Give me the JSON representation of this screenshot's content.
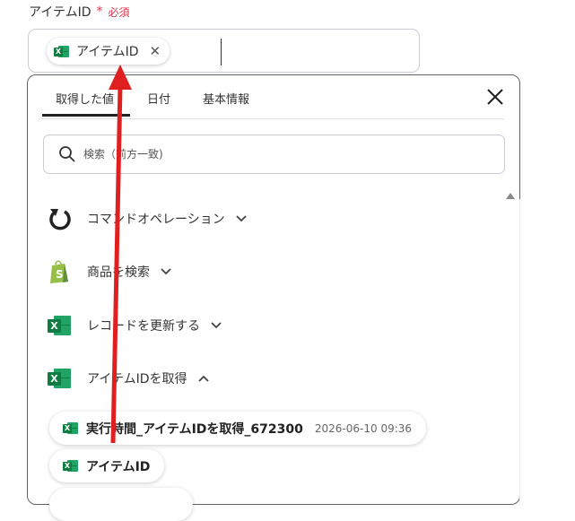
{
  "field": {
    "label": "アイテムID",
    "required_star": "*",
    "required_text": "必須",
    "chip_label": "アイテムID",
    "chip_close": "✕"
  },
  "panel": {
    "tabs": [
      {
        "label": "取得した値",
        "active": true
      },
      {
        "label": "日付",
        "active": false
      },
      {
        "label": "基本情報",
        "active": false
      }
    ],
    "close_icon": "close-icon",
    "search_placeholder": "検索（前方一致)"
  },
  "operations": [
    {
      "label": "コマンドオペレーション",
      "icon": "command-operation-icon",
      "expanded": false
    },
    {
      "label": "商品を検索",
      "icon": "shopify-icon",
      "expanded": false
    },
    {
      "label": "レコードを更新する",
      "icon": "excel-icon",
      "expanded": false
    },
    {
      "label": "アイテムIDを取得",
      "icon": "excel-icon",
      "expanded": true
    }
  ],
  "results": [
    {
      "label": "実行時間_アイテムIDを取得_672300",
      "timestamp": "2026-06-10 09:36"
    },
    {
      "label": "アイテムID"
    }
  ],
  "colors": {
    "required": "#e0344c",
    "excel_green": "#107c41",
    "shopify_green": "#95bf47",
    "annotation_arrow": "#e02020"
  }
}
